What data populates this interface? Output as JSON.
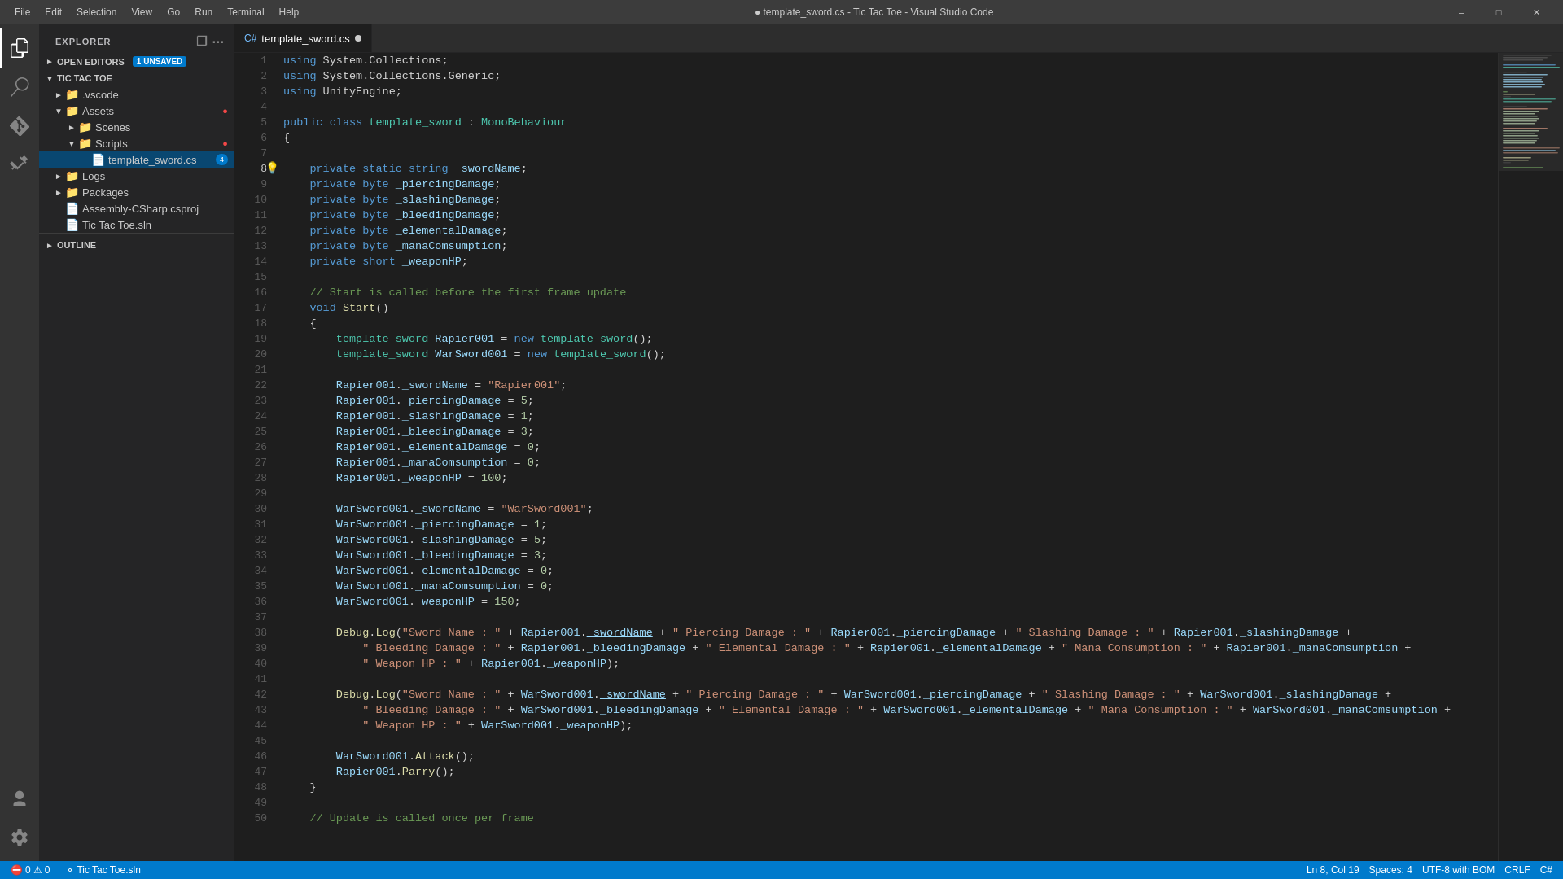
{
  "titlebar": {
    "title": "● template_sword.cs - Tic Tac Toe - Visual Studio Code",
    "menu": [
      "File",
      "Edit",
      "Selection",
      "View",
      "Go",
      "Run",
      "Terminal",
      "Help"
    ],
    "windowControls": [
      "minimize",
      "maximize",
      "close"
    ]
  },
  "sidebar": {
    "header": "EXPLORER",
    "openEditors": {
      "label": "OPEN EDITORS",
      "badge": "1 UNSAVED"
    },
    "project": {
      "name": "TIC TAC TOE",
      "items": [
        {
          "label": ".vscode",
          "indent": 1,
          "type": "folder",
          "expanded": false
        },
        {
          "label": "Assets",
          "indent": 1,
          "type": "folder",
          "expanded": true,
          "hasBadge": true
        },
        {
          "label": "Scenes",
          "indent": 2,
          "type": "folder",
          "expanded": false
        },
        {
          "label": "Scripts",
          "indent": 2,
          "type": "folder",
          "expanded": true,
          "hasBadge": true
        },
        {
          "label": "template_sword.cs",
          "indent": 3,
          "type": "file-cs",
          "active": true,
          "badge": 4
        },
        {
          "label": "Logs",
          "indent": 1,
          "type": "folder",
          "expanded": false
        },
        {
          "label": "Packages",
          "indent": 1,
          "type": "folder",
          "expanded": false
        },
        {
          "label": "Assembly-CSharp.csproj",
          "indent": 1,
          "type": "file-xml"
        },
        {
          "label": "Tic Tac Toe.sln",
          "indent": 1,
          "type": "file-sln"
        }
      ]
    },
    "outline": "OUTLINE"
  },
  "tab": {
    "filename": "template_sword.cs",
    "modified": true
  },
  "statusBar": {
    "errors": "0",
    "warnings": "0",
    "branch": "Tic Tac Toe.sln",
    "position": "Ln 8, Col 19",
    "spaces": "Spaces: 4",
    "encoding": "UTF-8 with BOM",
    "lineEnding": "CRLF",
    "language": "C#"
  },
  "code": {
    "lines": [
      {
        "n": 1,
        "html": "<span class='kw'>using</span> System.Collections;"
      },
      {
        "n": 2,
        "html": "<span class='kw'>using</span> System.Collections.Generic;"
      },
      {
        "n": 3,
        "html": "<span class='kw'>using</span> UnityEngine;"
      },
      {
        "n": 4,
        "html": ""
      },
      {
        "n": 5,
        "html": "<span class='kw'>public</span> <span class='kw'>class</span> <span class='cls'>template_sword</span> : <span class='type'>MonoBehaviour</span>"
      },
      {
        "n": 6,
        "html": "{"
      },
      {
        "n": 7,
        "html": ""
      },
      {
        "n": 8,
        "html": "    <span class='kw'>private</span> <span class='kw'>static</span> <span class='kw'>string</span> <span class='var'>_swordName</span>;"
      },
      {
        "n": 9,
        "html": "    <span class='kw'>private</span> <span class='kw'>byte</span> <span class='var'>_piercingDamage</span>;"
      },
      {
        "n": 10,
        "html": "    <span class='kw'>private</span> <span class='kw'>byte</span> <span class='var'>_slashingDamage</span>;"
      },
      {
        "n": 11,
        "html": "    <span class='kw'>private</span> <span class='kw'>byte</span> <span class='var'>_bleedingDamage</span>;"
      },
      {
        "n": 12,
        "html": "    <span class='kw'>private</span> <span class='kw'>byte</span> <span class='var'>_elementalDamage</span>;"
      },
      {
        "n": 13,
        "html": "    <span class='kw'>private</span> <span class='kw'>byte</span> <span class='var'>_manaComsumption</span>;"
      },
      {
        "n": 14,
        "html": "    <span class='kw'>private</span> <span class='kw'>short</span> <span class='var'>_weaponHP</span>;"
      },
      {
        "n": 15,
        "html": ""
      },
      {
        "n": 16,
        "html": "    <span class='comment'>// Start is called before the first frame update</span>"
      },
      {
        "n": 17,
        "html": "    <span class='kw'>void</span> <span class='fn'>Start</span>()"
      },
      {
        "n": 18,
        "html": "    {"
      },
      {
        "n": 19,
        "html": "        <span class='cls'>template_sword</span> <span class='var'>Rapier001</span> = <span class='kw'>new</span> <span class='cls'>template_sword</span>();"
      },
      {
        "n": 20,
        "html": "        <span class='cls'>template_sword</span> <span class='var'>WarSword001</span> = <span class='kw'>new</span> <span class='cls'>template_sword</span>();"
      },
      {
        "n": 21,
        "html": ""
      },
      {
        "n": 22,
        "html": "        <span class='var'>Rapier001</span>.<span class='var'>_swordName</span> = <span class='str'>\"Rapier001\"</span>;"
      },
      {
        "n": 23,
        "html": "        <span class='var'>Rapier001</span>.<span class='var'>_piercingDamage</span> = <span class='num'>5</span>;"
      },
      {
        "n": 24,
        "html": "        <span class='var'>Rapier001</span>.<span class='var'>_slashingDamage</span> = <span class='num'>1</span>;"
      },
      {
        "n": 25,
        "html": "        <span class='var'>Rapier001</span>.<span class='var'>_bleedingDamage</span> = <span class='num'>3</span>;"
      },
      {
        "n": 26,
        "html": "        <span class='var'>Rapier001</span>.<span class='var'>_elementalDamage</span> = <span class='num'>0</span>;"
      },
      {
        "n": 27,
        "html": "        <span class='var'>Rapier001</span>.<span class='var'>_manaComsumption</span> = <span class='num'>0</span>;"
      },
      {
        "n": 28,
        "html": "        <span class='var'>Rapier001</span>.<span class='var'>_weaponHP</span> = <span class='num'>100</span>;"
      },
      {
        "n": 29,
        "html": ""
      },
      {
        "n": 30,
        "html": "        <span class='var'>WarSword001</span>.<span class='var'>_swordName</span> = <span class='str'>\"WarSword001\"</span>;"
      },
      {
        "n": 31,
        "html": "        <span class='var'>WarSword001</span>.<span class='var'>_piercingDamage</span> = <span class='num'>1</span>;"
      },
      {
        "n": 32,
        "html": "        <span class='var'>WarSword001</span>.<span class='var'>_slashingDamage</span> = <span class='num'>5</span>;"
      },
      {
        "n": 33,
        "html": "        <span class='var'>WarSword001</span>.<span class='var'>_bleedingDamage</span> = <span class='num'>3</span>;"
      },
      {
        "n": 34,
        "html": "        <span class='var'>WarSword001</span>.<span class='var'>_elementalDamage</span> = <span class='num'>0</span>;"
      },
      {
        "n": 35,
        "html": "        <span class='var'>WarSword001</span>.<span class='var'>_manaComsumption</span> = <span class='num'>0</span>;"
      },
      {
        "n": 36,
        "html": "        <span class='var'>WarSword001</span>.<span class='var'>_weaponHP</span> = <span class='num'>150</span>;"
      },
      {
        "n": 37,
        "html": ""
      },
      {
        "n": 38,
        "html": "        <span class='fn'>Debug</span>.<span class='fn'>Log</span>(<span class='str'>\"Sword Name : \"</span> + <span class='var'>Rapier001</span>.<span class='var' style='text-decoration:underline'>_swordName</span> + <span class='str'>\" Piercing Damage : \"</span> + <span class='var'>Rapier001</span>.<span class='var'>_piercingDamage</span> + <span class='str'>\" Slashing Damage : \"</span> + <span class='var'>Rapier001</span>.<span class='var'>_slashingDamage</span> +"
      },
      {
        "n": 39,
        "html": "            <span class='str'>\" Bleeding Damage : \"</span> + <span class='var'>Rapier001</span>.<span class='var'>_bleedingDamage</span> + <span class='str'>\" Elemental Damage : \"</span> + <span class='var'>Rapier001</span>.<span class='var'>_elementalDamage</span> + <span class='str'>\" Mana Consumption : \"</span> + <span class='var'>Rapier001</span>.<span class='var'>_manaComsumption</span> +"
      },
      {
        "n": 40,
        "html": "            <span class='str'>\" Weapon HP : \"</span> + <span class='var'>Rapier001</span>.<span class='var'>_weaponHP</span>);"
      },
      {
        "n": 41,
        "html": ""
      },
      {
        "n": 42,
        "html": "        <span class='fn'>Debug</span>.<span class='fn'>Log</span>(<span class='str'>\"Sword Name : \"</span> + <span class='var'>WarSword001</span>.<span class='var' style='text-decoration:underline'>_swordName</span> + <span class='str'>\" Piercing Damage : \"</span> + <span class='var'>WarSword001</span>.<span class='var'>_piercingDamage</span> + <span class='str'>\" Slashing Damage : \"</span> + <span class='var'>WarSword001</span>.<span class='var'>_slashingDamage</span> +"
      },
      {
        "n": 43,
        "html": "            <span class='str'>\" Bleeding Damage : \"</span> + <span class='var'>WarSword001</span>.<span class='var'>_bleedingDamage</span> + <span class='str'>\" Elemental Damage : \"</span> + <span class='var'>WarSword001</span>.<span class='var'>_elementalDamage</span> + <span class='str'>\" Mana Consumption : \"</span> + <span class='var'>WarSword001</span>.<span class='var'>_manaComsumption</span> +"
      },
      {
        "n": 44,
        "html": "            <span class='str'>\" Weapon HP : \"</span> + <span class='var'>WarSword001</span>.<span class='var'>_weaponHP</span>);"
      },
      {
        "n": 45,
        "html": ""
      },
      {
        "n": 46,
        "html": "        <span class='var'>WarSword001</span>.<span class='fn'>Attack</span>();"
      },
      {
        "n": 47,
        "html": "        <span class='var'>Rapier001</span>.<span class='fn'>Parry</span>();"
      },
      {
        "n": 48,
        "html": "    }"
      },
      {
        "n": 49,
        "html": ""
      },
      {
        "n": 50,
        "html": "    <span class='comment'>// Update is called once per frame</span>"
      }
    ]
  }
}
